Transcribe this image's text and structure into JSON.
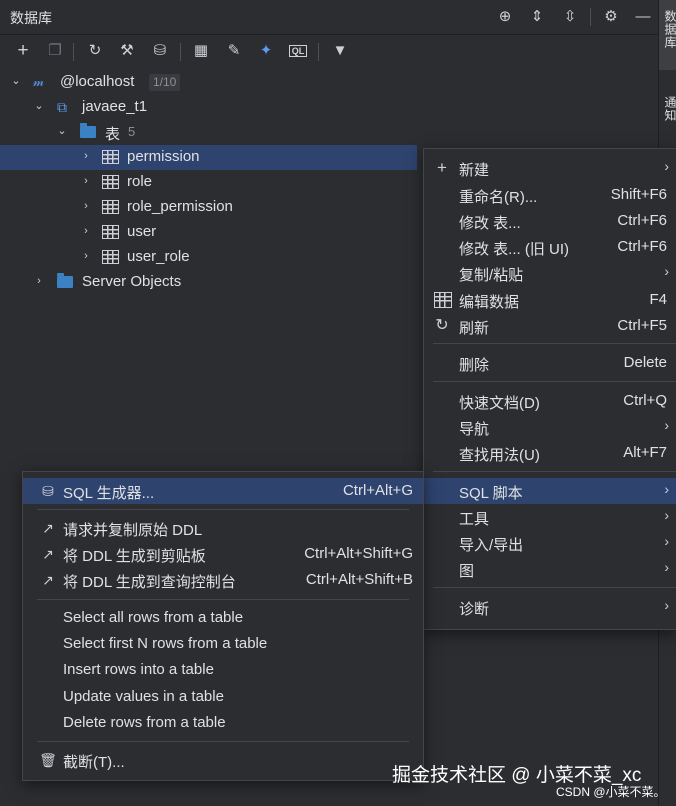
{
  "header": {
    "title": "数据库",
    "icons": [
      "crosshair-icon",
      "expand-all-icon",
      "collapse-all-icon",
      "gear-icon",
      "minimize-icon"
    ]
  },
  "toolbar": {
    "icons": [
      "add-icon",
      "duplicate-icon",
      "refresh-icon",
      "schema-settings-icon",
      "database-icon",
      "table-view-icon",
      "edit-icon",
      "jump-icon",
      "query-console-icon",
      "filter-icon"
    ],
    "query_label": "QL"
  },
  "side_strip": {
    "database_label": "数据库",
    "notifications_label": "通知"
  },
  "tree": {
    "connection": {
      "label": "@localhost",
      "badge": "1/10"
    },
    "schema": {
      "label": "javaee_t1"
    },
    "tables_folder": {
      "label": "表",
      "count": "5"
    },
    "tables": [
      "permission",
      "role",
      "role_permission",
      "user",
      "user_role"
    ],
    "server_objects": "Server Objects"
  },
  "context_menu": {
    "items": [
      {
        "label": "新建",
        "shortcut": "",
        "submenu": true,
        "icon": "plus-icon"
      },
      {
        "label": "重命名(R)...",
        "shortcut": "Shift+F6"
      },
      {
        "label": "修改 表...",
        "shortcut": "Ctrl+F6"
      },
      {
        "label": "修改 表... (旧 UI)",
        "shortcut": "Ctrl+F6"
      },
      {
        "label": "复制/粘贴",
        "shortcut": "",
        "submenu": true
      },
      {
        "label": "编辑数据",
        "shortcut": "F4",
        "icon": "table-icon"
      },
      {
        "label": "刷新",
        "shortcut": "Ctrl+F5",
        "icon": "refresh-icon"
      },
      {
        "label": "删除",
        "shortcut": "Delete"
      },
      {
        "label": "快速文档(D)",
        "shortcut": "Ctrl+Q"
      },
      {
        "label": "导航",
        "shortcut": "",
        "submenu": true
      },
      {
        "label": "查找用法(U)",
        "shortcut": "Alt+F7"
      },
      {
        "label": "SQL 脚本",
        "shortcut": "",
        "submenu": true,
        "highlighted": true
      },
      {
        "label": "工具",
        "shortcut": "",
        "submenu": true
      },
      {
        "label": "导入/导出",
        "shortcut": "",
        "submenu": true
      },
      {
        "label": "图",
        "shortcut": "",
        "submenu": true
      },
      {
        "label": "诊断",
        "shortcut": "",
        "submenu": true
      }
    ]
  },
  "sql_submenu": {
    "items": [
      {
        "label": "SQL 生成器...",
        "shortcut": "Ctrl+Alt+G",
        "highlighted": true,
        "icon": "database-stack-icon"
      },
      {
        "label": "请求并复制原始 DDL",
        "shortcut": "",
        "icon": "external-arrow-icon"
      },
      {
        "label": "将 DDL 生成到剪贴板",
        "shortcut": "Ctrl+Alt+Shift+G",
        "icon": "external-arrow-icon"
      },
      {
        "label": "将 DDL 生成到查询控制台",
        "shortcut": "Ctrl+Alt+Shift+B",
        "icon": "external-arrow-icon"
      },
      {
        "label": "Select all rows from a table",
        "shortcut": ""
      },
      {
        "label": "Select first N rows from a table",
        "shortcut": ""
      },
      {
        "label": "Insert rows into a table",
        "shortcut": ""
      },
      {
        "label": "Update values in a table",
        "shortcut": ""
      },
      {
        "label": "Delete rows from a table",
        "shortcut": ""
      },
      {
        "label": "截断(T)...",
        "shortcut": "",
        "icon": "trash-icon"
      }
    ]
  },
  "watermark": "掘金技术社区 @ 小菜不菜_xc",
  "csdn_mark": "CSDN @小菜不菜。",
  "colors": {
    "selection": "#2e436e",
    "background": "#2b2d30",
    "folder": "#3b82c4"
  }
}
